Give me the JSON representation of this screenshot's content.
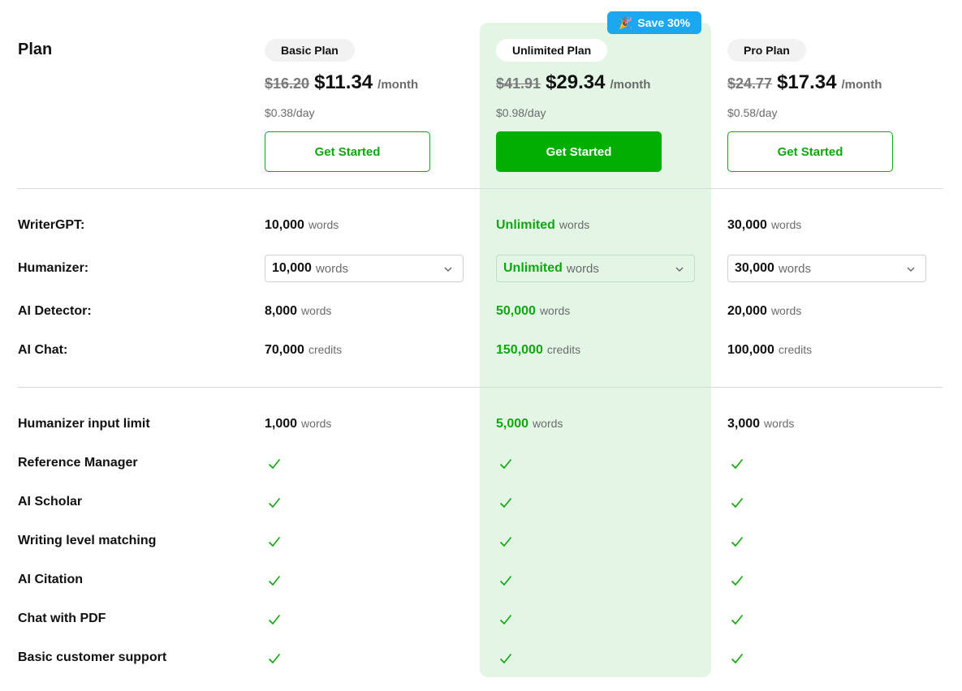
{
  "header": {
    "plan_label": "Plan",
    "badge": "Save 30%"
  },
  "plans": [
    {
      "name": "Basic Plan",
      "old_price": "$16.20",
      "price": "$11.34",
      "period": "/month",
      "daily": "$0.38/day",
      "cta": "Get Started"
    },
    {
      "name": "Unlimited Plan",
      "old_price": "$41.91",
      "price": "$29.34",
      "period": "/month",
      "daily": "$0.98/day",
      "cta": "Get Started"
    },
    {
      "name": "Pro Plan",
      "old_price": "$24.77",
      "price": "$17.34",
      "period": "/month",
      "daily": "$0.58/day",
      "cta": "Get Started"
    }
  ],
  "features": {
    "writergpt": {
      "label": "WriterGPT:",
      "values": [
        {
          "num": "10,000",
          "unit": "words"
        },
        {
          "num": "Unlimited",
          "unit": "words"
        },
        {
          "num": "30,000",
          "unit": "words"
        }
      ]
    },
    "humanizer": {
      "label": "Humanizer:",
      "values": [
        {
          "num": "10,000",
          "unit": "words"
        },
        {
          "num": "Unlimited",
          "unit": "words"
        },
        {
          "num": "30,000",
          "unit": "words"
        }
      ]
    },
    "detector": {
      "label": "AI Detector:",
      "values": [
        {
          "num": "8,000",
          "unit": "words"
        },
        {
          "num": "50,000",
          "unit": "words"
        },
        {
          "num": "20,000",
          "unit": "words"
        }
      ]
    },
    "chat": {
      "label": "AI Chat:",
      "values": [
        {
          "num": "70,000",
          "unit": "credits"
        },
        {
          "num": "150,000",
          "unit": "credits"
        },
        {
          "num": "100,000",
          "unit": "credits"
        }
      ]
    },
    "input_limit": {
      "label": "Humanizer input limit",
      "values": [
        {
          "num": "1,000",
          "unit": "words"
        },
        {
          "num": "5,000",
          "unit": "words"
        },
        {
          "num": "3,000",
          "unit": "words"
        }
      ]
    }
  },
  "checklist": [
    "Reference Manager",
    "AI Scholar",
    "Writing level matching",
    "AI Citation",
    "Chat with PDF",
    "Basic customer support"
  ],
  "colors": {
    "accent": "#11a611",
    "highlight": "#e3f6e6",
    "badge": "#1ba8f0"
  },
  "icons": {
    "check": "check-icon",
    "chevron": "chevron-down-icon",
    "badge": "party-popper-icon"
  }
}
